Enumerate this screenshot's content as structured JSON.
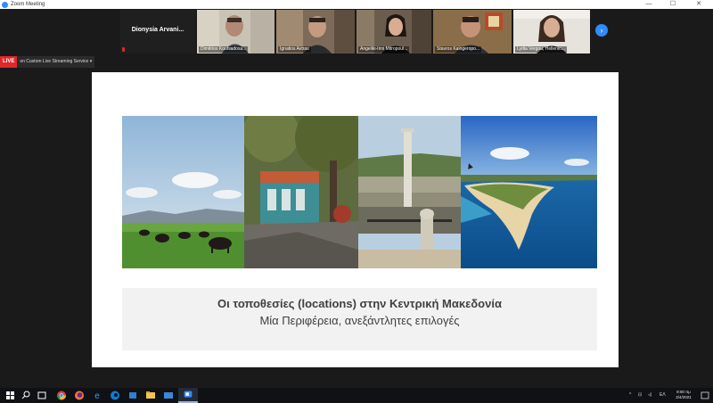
{
  "window": {
    "title": "Zoom Meeting",
    "minimize_glyph": "—",
    "maximize_glyph": "☐",
    "close_glyph": "✕"
  },
  "gallery": {
    "text_tile_name": "Dionysia  Arvani...",
    "participants": [
      {
        "name": "Dimitrios Kouhiadosa..."
      },
      {
        "name": "Ignatios Avtras"
      },
      {
        "name": "Angeliki-Irini Mitropoul..."
      },
      {
        "name": "Stavros Kalogeropo..."
      },
      {
        "name": "Lydia Vergou, Hellenic..."
      }
    ],
    "next_page_glyph": "›"
  },
  "live": {
    "badge": "LIVE",
    "service": "on Custom Live Streaming Service",
    "chevron": "▾"
  },
  "slide": {
    "title": "Οι τοποθεσίες (locations) στην Κεντρική Μακεδονία",
    "subtitle": "Μία Περιφέρεια, ανεξάντλητες επιλογές"
  },
  "taskbar": {
    "lang": "ΕΛ",
    "time": "9:00 πμ",
    "date": "2/4/2021",
    "tray_icons": [
      "^",
      "⊡",
      "◃)"
    ]
  },
  "colors": {
    "zoom_blue": "#2d8cff",
    "live_red": "#e02828",
    "slide_text": "#404040"
  }
}
